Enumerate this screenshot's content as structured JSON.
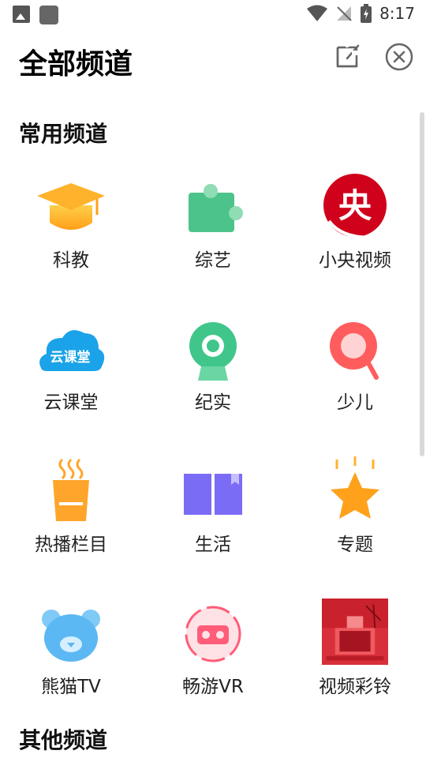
{
  "status": {
    "time": "8:17"
  },
  "header": {
    "title": "全部频道"
  },
  "sections": {
    "common": "常用频道",
    "other": "其他频道"
  },
  "channels": [
    {
      "label": "科教",
      "icon": "graduation-cap-icon"
    },
    {
      "label": "综艺",
      "icon": "puzzle-piece-icon"
    },
    {
      "label": "小央视频",
      "icon": "yang-logo-icon"
    },
    {
      "label": "云课堂",
      "icon": "cloud-class-icon"
    },
    {
      "label": "纪实",
      "icon": "webcam-icon"
    },
    {
      "label": "少儿",
      "icon": "magnifier-icon"
    },
    {
      "label": "热播栏目",
      "icon": "hot-cup-icon"
    },
    {
      "label": "生活",
      "icon": "open-book-icon"
    },
    {
      "label": "专题",
      "icon": "star-icon"
    },
    {
      "label": "熊猫TV",
      "icon": "panda-icon"
    },
    {
      "label": "畅游VR",
      "icon": "vr-headset-icon"
    },
    {
      "label": "视频彩铃",
      "icon": "ringtone-thumbnail"
    }
  ],
  "cloud_icon_text": "云课堂",
  "yang_icon_text": "央"
}
